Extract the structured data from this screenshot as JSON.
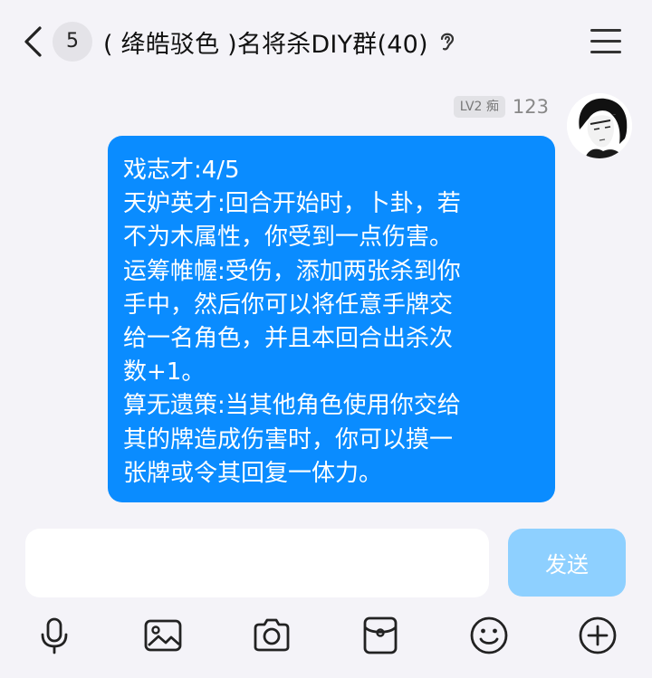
{
  "header": {
    "unread_count": "5",
    "title": "( 绛皓驳色 )名将杀DIY群(40)"
  },
  "message": {
    "sender_level": "LV2 痴",
    "sender_name": "123",
    "lines": [
      "戏志才:4/5",
      "天妒英才:回合开始时，卜卦，若",
      "不为木属性，你受到一点伤害。",
      "运筹帷幄:受伤，添加两张杀到你",
      "手中，然后你可以将任意手牌交",
      "给一名角色，并且本回合出杀次",
      "数+1。",
      "算无遗策:当其他角色使用你交给",
      "其的牌造成伤害时，你可以摸一",
      "张牌或令其回复一体力。"
    ],
    "bubble_color": "#0a8cff"
  },
  "input": {
    "value": "",
    "placeholder": "",
    "send_label": "发送"
  },
  "toolbar": {
    "icons": [
      "microphone-icon",
      "image-icon",
      "camera-icon",
      "red-packet-icon",
      "emoji-icon",
      "plus-icon"
    ]
  },
  "colors": {
    "background": "#f4f3f8",
    "accent": "#0a8cff",
    "send_disabled": "#8ed0ff"
  }
}
